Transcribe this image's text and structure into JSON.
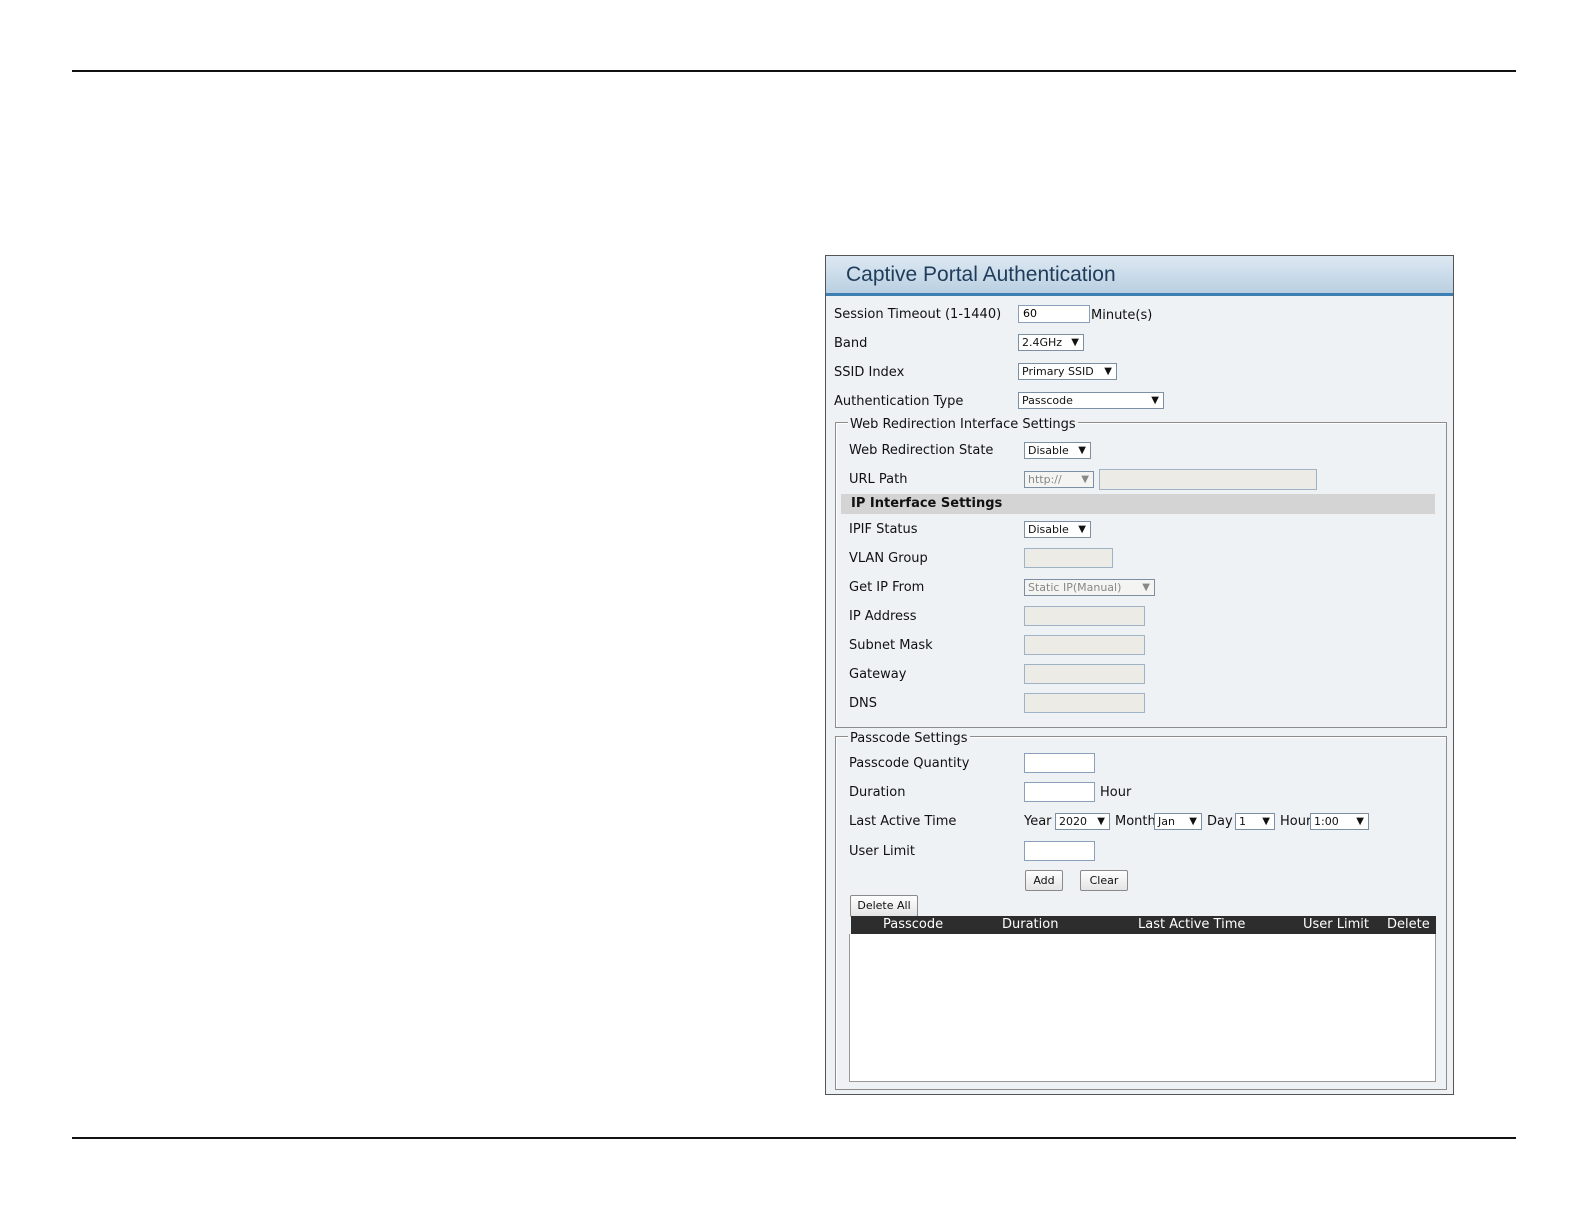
{
  "panel": {
    "title": "Captive Portal Authentication"
  },
  "session": {
    "label": "Session Timeout (1-1440)",
    "value": "60",
    "unit": "Minute(s)"
  },
  "band": {
    "label": "Band",
    "value": "2.4GHz"
  },
  "ssid": {
    "label": "SSID Index",
    "value": "Primary SSID"
  },
  "auth": {
    "label": "Authentication Type",
    "value": "Passcode"
  },
  "web": {
    "legend": "Web Redirection Interface Settings",
    "state_label": "Web Redirection State",
    "state_value": "Disable",
    "url_label": "URL Path",
    "url_scheme": "http://",
    "url_value": ""
  },
  "ip": {
    "heading": "IP Interface Settings",
    "ipif_label": "IPIF Status",
    "ipif_value": "Disable",
    "vlan_label": "VLAN Group",
    "getip_label": "Get IP From",
    "getip_value": "Static IP(Manual)",
    "addr_label": "IP Address",
    "mask_label": "Subnet Mask",
    "gw_label": "Gateway",
    "dns_label": "DNS"
  },
  "passcode": {
    "legend": "Passcode Settings",
    "qty_label": "Passcode Quantity",
    "dur_label": "Duration",
    "dur_unit": "Hour",
    "lat_label": "Last Active Time",
    "year_label": "Year",
    "year_value": "2020",
    "month_label": "Month",
    "month_value": "Jan",
    "day_label": "Day",
    "day_value": "1",
    "hour_label": "Hour",
    "hour_value": "1:00",
    "ul_label": "User Limit",
    "add": "Add",
    "clear": "Clear",
    "delete_all": "Delete All"
  },
  "table": {
    "columns": [
      "Passcode",
      "Duration",
      "Last Active Time",
      "User Limit",
      "Delete"
    ]
  },
  "colors": {
    "header_accent": "#3d7fb3",
    "table_head": "#2d2d2d"
  }
}
